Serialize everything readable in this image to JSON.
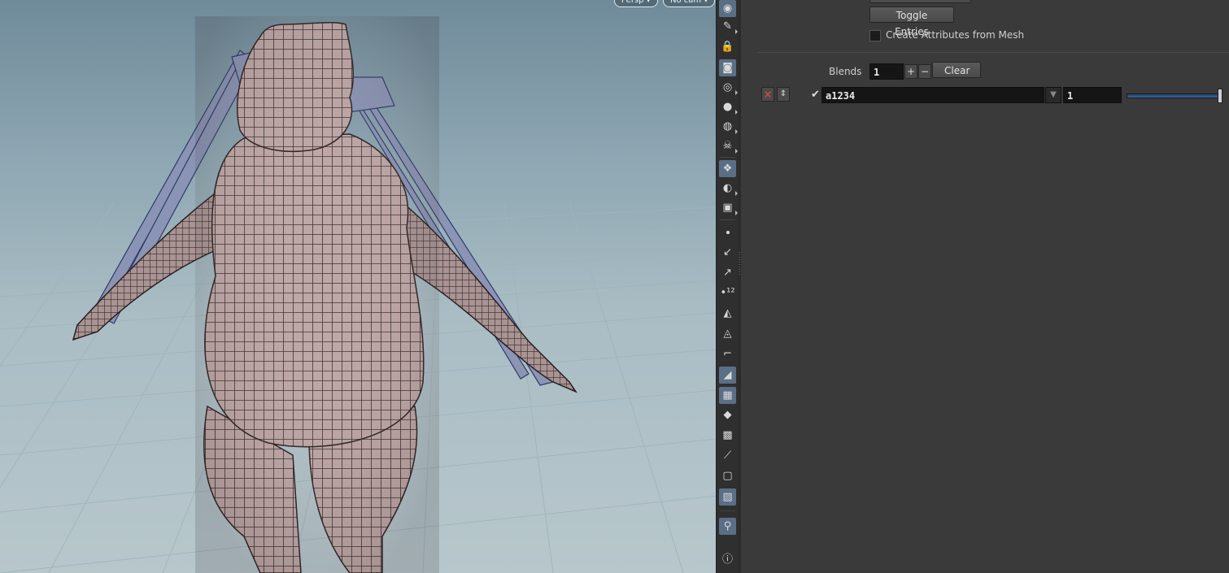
{
  "viewport": {
    "camera_menu_label": "Persp ▾",
    "camera_select_label": "No cam ▾"
  },
  "toolbar": {
    "icons": [
      "display-options-icon",
      "selection-brush-icon",
      "lock-camera-icon",
      "show-ghost-icon",
      "shading-sphere-icon",
      "light-bulb-icon",
      "headlight-icon",
      "skull-icon",
      "display-mode-icon",
      "visibility-eye-icon",
      "camera-settings-icon",
      "point-display-icon",
      "normal-display-icon",
      "vector-display-icon",
      "point-numbers-icon",
      "prim-normals-icon",
      "prim-numbers-icon",
      "profile-curve-icon",
      "template-geometry-icon",
      "texture-display-icon",
      "diamond-icon",
      "uv-display-icon",
      "handle-display-icon",
      "safe-area-icon",
      "background-image-icon",
      "location-pin-icon",
      "info-icon"
    ]
  },
  "panel": {
    "toggle_entries_label": "Toggle Entries",
    "create_attributes_label": "Create Attributes from Mesh",
    "blends_label": "Blends",
    "blends_value": "1",
    "plus_label": "+",
    "minus_label": "−",
    "clear_label": "Clear",
    "entry": {
      "remove_label": "×",
      "move_label": "⇕",
      "name_value": "a1234",
      "weight_value": "1",
      "weight_fraction": 1.0
    }
  },
  "colors": {
    "panel_bg": "#3a3a3a",
    "field_bg": "#151515",
    "slider_fill": "#3a66a3",
    "toolbar_active": "#5a6f86",
    "remove_red": "#d24a4a"
  }
}
